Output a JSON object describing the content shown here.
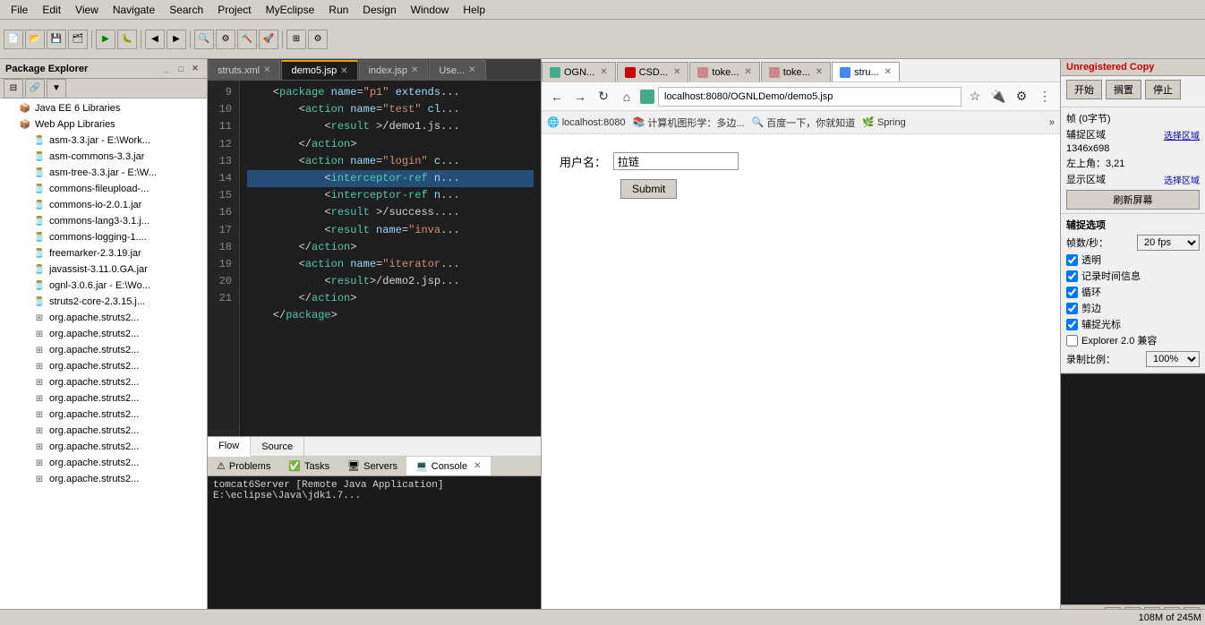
{
  "menubar": {
    "items": [
      "File",
      "Edit",
      "View",
      "Navigate",
      "Search",
      "Project",
      "MyEclipse",
      "Run",
      "Design",
      "Window",
      "Help"
    ]
  },
  "left_panel": {
    "title": "Package Explorer",
    "tree": [
      {
        "label": "Java EE 6 Libraries",
        "indent": 1,
        "icon": "📦"
      },
      {
        "label": "Web App Libraries",
        "indent": 1,
        "icon": "📦"
      },
      {
        "label": "asm-3.3.jar - E:\\Work...",
        "indent": 2,
        "icon": "🫙"
      },
      {
        "label": "asm-commons-3.3.jar",
        "indent": 2,
        "icon": "🫙"
      },
      {
        "label": "asm-tree-3.3.jar - E:\\W...",
        "indent": 2,
        "icon": "🫙"
      },
      {
        "label": "commons-fileupload-...",
        "indent": 2,
        "icon": "🫙"
      },
      {
        "label": "commons-io-2.0.1.jar",
        "indent": 2,
        "icon": "🫙"
      },
      {
        "label": "commons-lang3-3.1.j...",
        "indent": 2,
        "icon": "🫙"
      },
      {
        "label": "commons-logging-1....",
        "indent": 2,
        "icon": "🫙"
      },
      {
        "label": "freemarker-2.3.19.jar",
        "indent": 2,
        "icon": "🫙"
      },
      {
        "label": "javassist-3.11.0.GA.jar",
        "indent": 2,
        "icon": "🫙"
      },
      {
        "label": "ognl-3.0.6.jar - E:\\Wo...",
        "indent": 2,
        "icon": "🫙"
      },
      {
        "label": "struts2-core-2.3.15.j...",
        "indent": 2,
        "icon": "🫙"
      },
      {
        "label": "org.apache.struts2...",
        "indent": 2,
        "icon": "⊞"
      },
      {
        "label": "org.apache.struts2...",
        "indent": 2,
        "icon": "⊞"
      },
      {
        "label": "org.apache.struts2...",
        "indent": 2,
        "icon": "⊞"
      },
      {
        "label": "org.apache.struts2...",
        "indent": 2,
        "icon": "⊞"
      },
      {
        "label": "org.apache.struts2...",
        "indent": 2,
        "icon": "⊞"
      },
      {
        "label": "org.apache.struts2...",
        "indent": 2,
        "icon": "⊞"
      },
      {
        "label": "org.apache.struts2...",
        "indent": 2,
        "icon": "⊞"
      },
      {
        "label": "org.apache.struts2...",
        "indent": 2,
        "icon": "⊞"
      },
      {
        "label": "org.apache.struts2...",
        "indent": 2,
        "icon": "⊞"
      },
      {
        "label": "org.apache.struts2...",
        "indent": 2,
        "icon": "⊞"
      },
      {
        "label": "org.apache.struts2...",
        "indent": 2,
        "icon": "⊞"
      }
    ]
  },
  "editor": {
    "tabs": [
      {
        "label": "struts.xml",
        "active": false,
        "icon": "📄"
      },
      {
        "label": "demo5.jsp",
        "active": true,
        "icon": "📄"
      },
      {
        "label": "index.jsp",
        "active": false,
        "icon": "📄"
      },
      {
        "label": "Use...",
        "active": false,
        "icon": "📄"
      }
    ],
    "lines": [
      {
        "num": "9",
        "code": "    <package name=\"p1\" extends...",
        "classes": ""
      },
      {
        "num": "10",
        "code": "        <action name=\"test\" cl...",
        "classes": ""
      },
      {
        "num": "11",
        "code": "            <result >/demo1.js...",
        "classes": ""
      },
      {
        "num": "12",
        "code": "        </action>",
        "classes": ""
      },
      {
        "num": "13",
        "code": "        <action name=\"login\" c...",
        "classes": ""
      },
      {
        "num": "14",
        "code": "            <interceptor-ref n...",
        "classes": "selected"
      },
      {
        "num": "15",
        "code": "            <interceptor-ref n...",
        "classes": ""
      },
      {
        "num": "16",
        "code": "            <result >/success....",
        "classes": ""
      },
      {
        "num": "17",
        "code": "            <result name=\"inva...",
        "classes": ""
      },
      {
        "num": "18",
        "code": "        </action>",
        "classes": ""
      },
      {
        "num": "19",
        "code": "        <action name=\"iterator...",
        "classes": ""
      },
      {
        "num": "20",
        "code": "            <result>/demo2.jsp...",
        "classes": ""
      },
      {
        "num": "21",
        "code": "        </action>",
        "classes": ""
      },
      {
        "num": "",
        "code": "    </package>",
        "classes": ""
      }
    ]
  },
  "bottom": {
    "flow_tab": "Flow",
    "source_tab": "Source",
    "console_tabs": [
      "Problems",
      "Tasks",
      "Servers",
      "Console"
    ],
    "console_active": "Console",
    "console_text": "tomcat6Server [Remote Java Application] E:\\eclipse\\Java\\jdk1.7..."
  },
  "browser": {
    "tabs": [
      {
        "label": "OGN...",
        "active": false
      },
      {
        "label": "CSD...",
        "active": false
      },
      {
        "label": "toke...",
        "active": false
      },
      {
        "label": "toke...",
        "active": false
      },
      {
        "label": "stru...",
        "active": true
      }
    ],
    "url": "localhost:8080/OGNLDemo/demo5.jsp",
    "bookmarks": [
      {
        "label": "localhost:8080"
      },
      {
        "label": "计算机图形学：多边..."
      },
      {
        "label": "百度一下，你就知道"
      },
      {
        "label": "Spring"
      }
    ],
    "form": {
      "label": "用户名：",
      "placeholder": "拉链",
      "submit": "Submit"
    }
  },
  "right_panel": {
    "title": "Unregistered Copy",
    "buttons": {
      "start": "开始",
      "pause": "搁置",
      "stop": "停止"
    },
    "info": {
      "frame_label": "帧 (0字节)",
      "size_label": "辅捉区域",
      "dimensions": "1346x698",
      "corner": "左上角：3,21",
      "display_label": "显示区域",
      "select_label": "选择区域"
    },
    "refresh_btn": "刷新屏幕",
    "options_title": "辅捉选项",
    "fps_label": "帧数/秒：",
    "fps_value": "20 fps▼",
    "checkboxes": [
      {
        "label": "透明",
        "checked": true
      },
      {
        "label": "记录时间信息",
        "checked": true
      },
      {
        "label": "循环",
        "checked": true
      },
      {
        "label": "剪边",
        "checked": true
      },
      {
        "label": "辅捉光标",
        "checked": true
      },
      {
        "label": "Explorer 2.0 兼容",
        "checked": false
      }
    ],
    "scale_label": "录制比例：",
    "scale_value": "100%▼"
  },
  "status_bar": {
    "memory": "108M of 245M"
  }
}
